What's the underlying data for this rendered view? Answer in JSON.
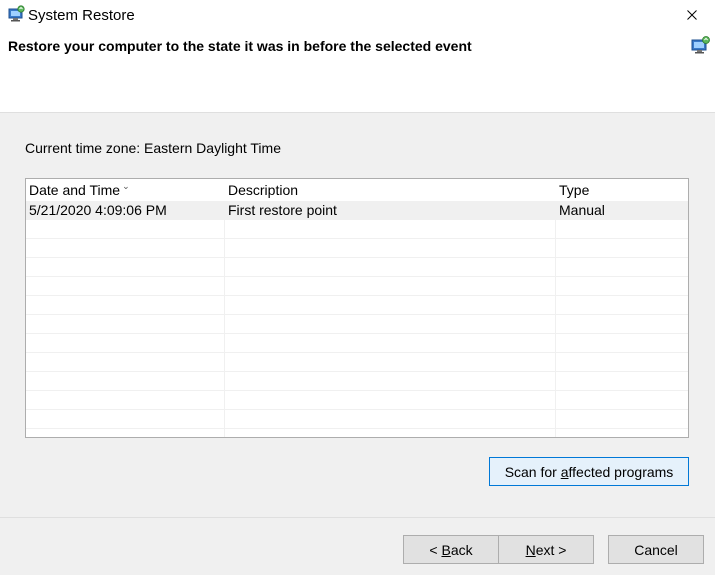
{
  "window": {
    "title": "System Restore",
    "heading": "Restore your computer to the state it was in before the selected event",
    "icon": "system-restore-icon"
  },
  "timezone_label": "Current time zone: Eastern Daylight Time",
  "restore_points": {
    "columns": [
      "Date and Time",
      "Description",
      "Type"
    ],
    "sort_column": "Date and Time",
    "rows": [
      {
        "date_time": "5/21/2020 4:09:06 PM",
        "description": "First restore point",
        "type": "Manual",
        "selected": true
      }
    ]
  },
  "buttons": {
    "scan_prefix": "Scan for ",
    "scan_underlined": "a",
    "scan_suffix": "ffected programs",
    "back_prefix": "< ",
    "back_underlined": "B",
    "back_suffix": "ack",
    "next_underlined": "N",
    "next_suffix": "ext >",
    "cancel": "Cancel"
  },
  "colors": {
    "selection": "#f0f0f0",
    "default_button_border": "#0078d7",
    "dialog_bg": "#f0f0f0"
  }
}
